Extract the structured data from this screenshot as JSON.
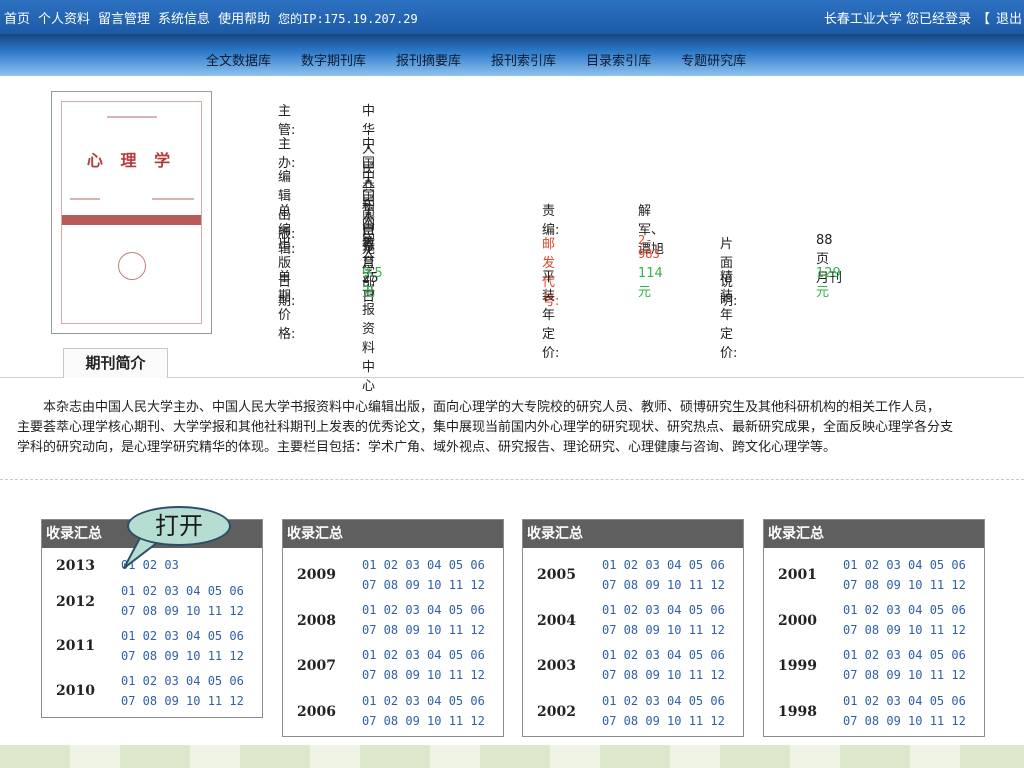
{
  "topbar": {
    "links": [
      "首页",
      "个人资料",
      "留言管理",
      "系统信息",
      "使用帮助"
    ],
    "ip": "您的IP:175.19.207.29",
    "right_user": "长春工业大学 您已经登录",
    "bracket": "【",
    "logout": "退出"
  },
  "nav": {
    "items": [
      "全文数据库",
      "数字期刊库",
      "报刊摘要库",
      "报刊索引库",
      "目录索引库",
      "专题研究库"
    ]
  },
  "cover": {
    "title": "心 理 学"
  },
  "info": {
    "supervisor_label": "主　管:",
    "supervisor": "中华人民共和国教育部",
    "sponsor_label": "主　办:",
    "sponsor": "中国人民大学",
    "publisher_label": "编辑出版:",
    "publisher": "中国人民大学书报资料中心",
    "editor_label": "总 编 辑:",
    "editor": "高自龙",
    "resp_label": "责　　编:",
    "resp": "解军、谭旭",
    "date_label": "出版日期:",
    "date": "每月25日",
    "postcode_label": "邮发代号:",
    "postcode": "2-983",
    "pages_label": "片面说明:",
    "pages": "88页　月刊",
    "price_label": "单期价格:",
    "price": "9.5元",
    "paper_label": "平装年定价:",
    "paper": "114元",
    "hard_label": "精装年定价:",
    "hard": "129元"
  },
  "intro": {
    "tab": "期刊简介",
    "line1": "　　本杂志由中国人民大学主办、中国人民大学书报资料中心编辑出版，面向心理学的大专院校的研究人员、教师、硕博研究生及其他科研机构的相关工作人员，",
    "line2": "主要荟萃心理学核心期刊、大学学报和其他社科期刊上发表的优秀论文，集中展现当前国内外心理学的研究现状、研究热点、最新研究成果，全面反映心理学各分支",
    "line3": "学科的研究动向，是心理学研究精华的体现。主要栏目包括：学术广角、域外视点、研究报告、理论研究、心理健康与咨询、跨文化心理学等。"
  },
  "callout": "打开",
  "archives": [
    {
      "header": "收录汇总",
      "years": [
        {
          "year": "2013",
          "l1": "01 02 03",
          "l2": ""
        },
        {
          "year": "2012",
          "l1": "01 02 03 04 05 06",
          "l2": "07 08 09 10 11 12"
        },
        {
          "year": "2011",
          "l1": "01 02 03 04 05 06",
          "l2": "07 08 09 10 11 12"
        },
        {
          "year": "2010",
          "l1": "01 02 03 04 05 06",
          "l2": "07 08 09 10 11 12"
        }
      ]
    },
    {
      "header": "收录汇总",
      "years": [
        {
          "year": "2009",
          "l1": "01 02 03 04 05 06",
          "l2": "07 08 09 10 11 12"
        },
        {
          "year": "2008",
          "l1": "01 02 03 04 05 06",
          "l2": "07 08 09 10 11 12"
        },
        {
          "year": "2007",
          "l1": "01 02 03 04 05 06",
          "l2": "07 08 09 10 11 12"
        },
        {
          "year": "2006",
          "l1": "01 02 03 04 05 06",
          "l2": "07 08 09 10 11 12"
        }
      ]
    },
    {
      "header": "收录汇总",
      "years": [
        {
          "year": "2005",
          "l1": "01 02 03 04 05 06",
          "l2": "07 08 09 10 11 12"
        },
        {
          "year": "2004",
          "l1": "01 02 03 04 05 06",
          "l2": "07 08 09 10 11 12"
        },
        {
          "year": "2003",
          "l1": "01 02 03 04 05 06",
          "l2": "07 08 09 10 11 12"
        },
        {
          "year": "2002",
          "l1": "01 02 03 04 05 06",
          "l2": "07 08 09 10 11 12"
        }
      ]
    },
    {
      "header": "收录汇总",
      "years": [
        {
          "year": "2001",
          "l1": "01 02 03 04 05 06",
          "l2": "07 08 09 10 11 12"
        },
        {
          "year": "2000",
          "l1": "01 02 03 04 05 06",
          "l2": "07 08 09 10 11 12"
        },
        {
          "year": "1999",
          "l1": "01 02 03 04 05 06",
          "l2": "07 08 09 10 11 12"
        },
        {
          "year": "1998",
          "l1": "01 02 03 04 05 06",
          "l2": "07 08 09 10 11 12"
        }
      ]
    }
  ],
  "colors": {
    "topbar": "#1c5aa6",
    "link": "#2f5fa8",
    "price": "#32b44a",
    "postcode": "#e0462a",
    "callout": "#b6ddd2"
  }
}
